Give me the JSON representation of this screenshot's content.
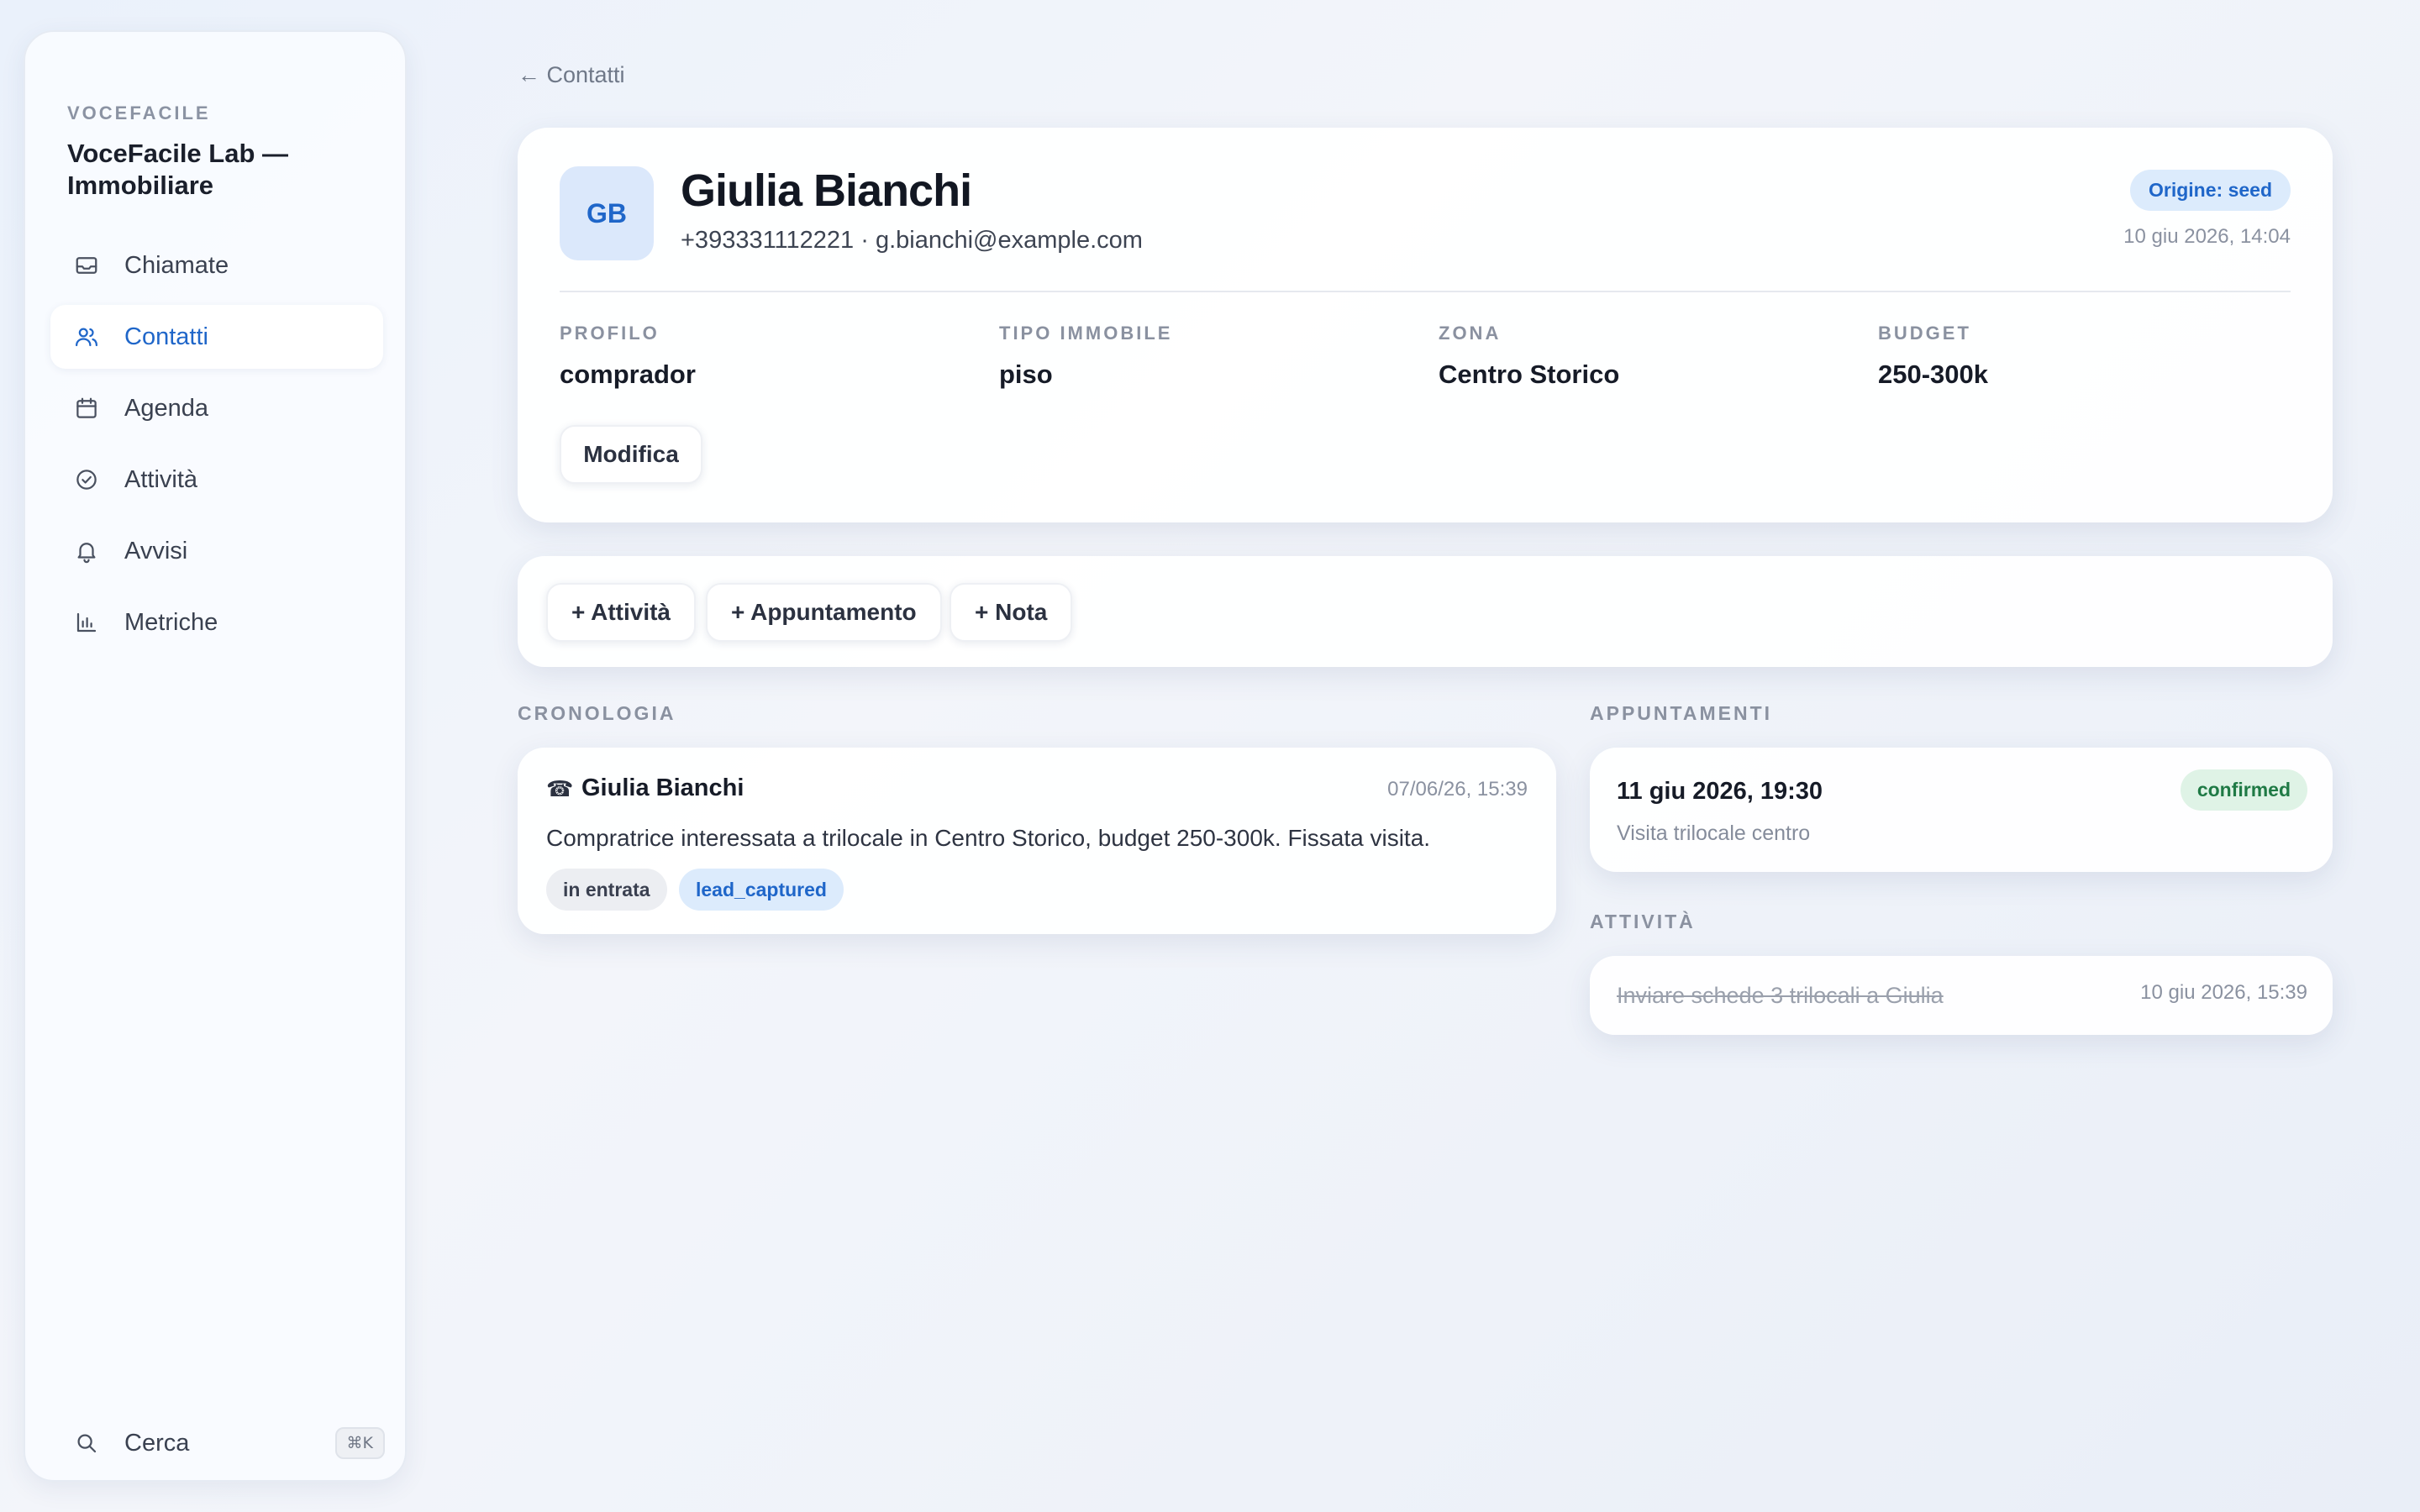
{
  "sidebar": {
    "kicker": "VOCEFACILE",
    "title": "VoceFacile Lab — Immobiliare",
    "items": [
      {
        "label": "Chiamate",
        "icon": "inbox-icon"
      },
      {
        "label": "Contatti",
        "icon": "users-icon"
      },
      {
        "label": "Agenda",
        "icon": "calendar-icon"
      },
      {
        "label": "Attività",
        "icon": "check-circle-icon"
      },
      {
        "label": "Avvisi",
        "icon": "bell-icon"
      },
      {
        "label": "Metriche",
        "icon": "bar-chart-icon"
      }
    ],
    "active_item": "Contatti",
    "search_label": "Cerca",
    "search_shortcut": "⌘K"
  },
  "back_link": "← Contatti",
  "contact": {
    "initials": "GB",
    "name": "Giulia Bianchi",
    "subline": "+393331112221 · g.bianchi@example.com",
    "origin_badge": "Origine: seed",
    "created_at": "10 giu 2026, 14:04",
    "fields": [
      {
        "label": "PROFILO",
        "value": "comprador"
      },
      {
        "label": "TIPO IMMOBILE",
        "value": "piso"
      },
      {
        "label": "ZONA",
        "value": "Centro Storico"
      },
      {
        "label": "BUDGET",
        "value": "250-300k"
      }
    ],
    "edit_label": "Modifica"
  },
  "actions": {
    "add_activity": "+ Attività",
    "add_appointment": "+ Appuntamento",
    "add_note": "+ Nota"
  },
  "timeline": {
    "section_label": "CRONOLOGIA",
    "entry": {
      "icon": "phone-icon",
      "title": "Giulia Bianchi",
      "time": "07/06/26, 15:39",
      "text": "Compratrice interessata a trilocale in Centro Storico, budget 250-300k. Fissata visita.",
      "tags": [
        "in entrata",
        "lead_captured"
      ]
    }
  },
  "appointments": {
    "section_label": "APPUNTAMENTI",
    "item": {
      "date": "11 giu 2026, 19:30",
      "description": "Visita trilocale centro",
      "status": "confirmed"
    }
  },
  "activities": {
    "section_label": "ATTIVITÀ",
    "item": {
      "text": "Inviare schede 3 trilocali a Giulia",
      "time": "10 giu 2026, 15:39",
      "completed": true
    }
  },
  "colors": {
    "accent": "#1f66c9",
    "success": "#1f7a45"
  }
}
